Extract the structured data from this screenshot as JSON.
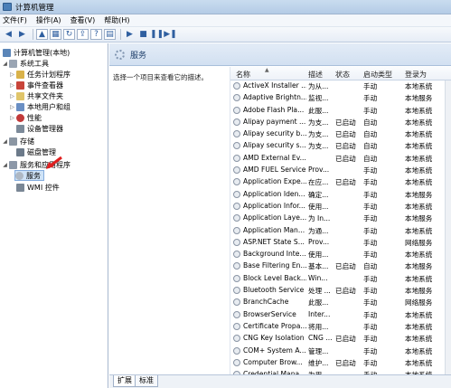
{
  "window": {
    "title": "计算机管理"
  },
  "menu": [
    "文件(F)",
    "操作(A)",
    "查看(V)",
    "帮助(H)"
  ],
  "tree": {
    "root": "计算机管理(本地)",
    "items": [
      "系统工具",
      "任务计划程序",
      "事件查看器",
      "共享文件夹",
      "本地用户和组",
      "性能",
      "设备管理器",
      "存储",
      "磁盘管理",
      "服务和应用程序",
      "服务",
      "WMI 控件"
    ]
  },
  "panel": {
    "title": "服务",
    "description": "选择一个项目来查看它的描述。",
    "headers": [
      "名称",
      "描述",
      "状态",
      "启动类型",
      "登录为"
    ]
  },
  "services": [
    {
      "name": "ActiveX Installer ...",
      "desc": "为从...",
      "status": "",
      "startup": "手动",
      "logon": "本地系统"
    },
    {
      "name": "Adaptive Brightn...",
      "desc": "监视...",
      "status": "",
      "startup": "手动",
      "logon": "本地服务"
    },
    {
      "name": "Adobe Flash Pla...",
      "desc": "此服...",
      "status": "",
      "startup": "手动",
      "logon": "本地系统"
    },
    {
      "name": "Alipay payment ...",
      "desc": "为支...",
      "status": "已启动",
      "startup": "自动",
      "logon": "本地系统"
    },
    {
      "name": "Alipay security b...",
      "desc": "为支...",
      "status": "已启动",
      "startup": "自动",
      "logon": "本地系统"
    },
    {
      "name": "Alipay security s...",
      "desc": "为支...",
      "status": "已启动",
      "startup": "自动",
      "logon": "本地系统"
    },
    {
      "name": "AMD External Ev...",
      "desc": "",
      "status": "已启动",
      "startup": "自动",
      "logon": "本地系统"
    },
    {
      "name": "AMD FUEL Service",
      "desc": "Prov...",
      "status": "",
      "startup": "手动",
      "logon": "本地系统"
    },
    {
      "name": "Application Expe...",
      "desc": "在应...",
      "status": "已启动",
      "startup": "手动",
      "logon": "本地系统"
    },
    {
      "name": "Application Iden...",
      "desc": "确定...",
      "status": "",
      "startup": "手动",
      "logon": "本地服务"
    },
    {
      "name": "Application Infor...",
      "desc": "使用...",
      "status": "",
      "startup": "手动",
      "logon": "本地系统"
    },
    {
      "name": "Application Laye...",
      "desc": "为 In...",
      "status": "",
      "startup": "手动",
      "logon": "本地服务"
    },
    {
      "name": "Application Man...",
      "desc": "为通...",
      "status": "",
      "startup": "手动",
      "logon": "本地系统"
    },
    {
      "name": "ASP.NET State S...",
      "desc": "Prov...",
      "status": "",
      "startup": "手动",
      "logon": "网络服务"
    },
    {
      "name": "Background Inte...",
      "desc": "使用...",
      "status": "",
      "startup": "手动",
      "logon": "本地系统"
    },
    {
      "name": "Base Filtering En...",
      "desc": "基本...",
      "status": "已启动",
      "startup": "自动",
      "logon": "本地服务"
    },
    {
      "name": "Block Level Back...",
      "desc": "Win...",
      "status": "",
      "startup": "手动",
      "logon": "本地系统"
    },
    {
      "name": "Bluetooth Service",
      "desc": "处理 ...",
      "status": "已启动",
      "startup": "手动",
      "logon": "本地服务"
    },
    {
      "name": "BranchCache",
      "desc": "此服...",
      "status": "",
      "startup": "手动",
      "logon": "网络服务"
    },
    {
      "name": "BrowserService",
      "desc": "Inter...",
      "status": "",
      "startup": "手动",
      "logon": "本地系统"
    },
    {
      "name": "Certificate Propa...",
      "desc": "将用...",
      "status": "",
      "startup": "手动",
      "logon": "本地系统"
    },
    {
      "name": "CNG Key Isolation",
      "desc": "CNG ...",
      "status": "已启动",
      "startup": "手动",
      "logon": "本地系统"
    },
    {
      "name": "COM+ System A...",
      "desc": "管理...",
      "status": "",
      "startup": "手动",
      "logon": "本地系统"
    },
    {
      "name": "Computer Brow...",
      "desc": "维护...",
      "status": "已启动",
      "startup": "手动",
      "logon": "本地系统"
    },
    {
      "name": "Credential Mana...",
      "desc": "为用...",
      "status": "",
      "startup": "手动",
      "logon": "本地系统"
    }
  ],
  "tabs": [
    "扩展",
    "标准"
  ]
}
